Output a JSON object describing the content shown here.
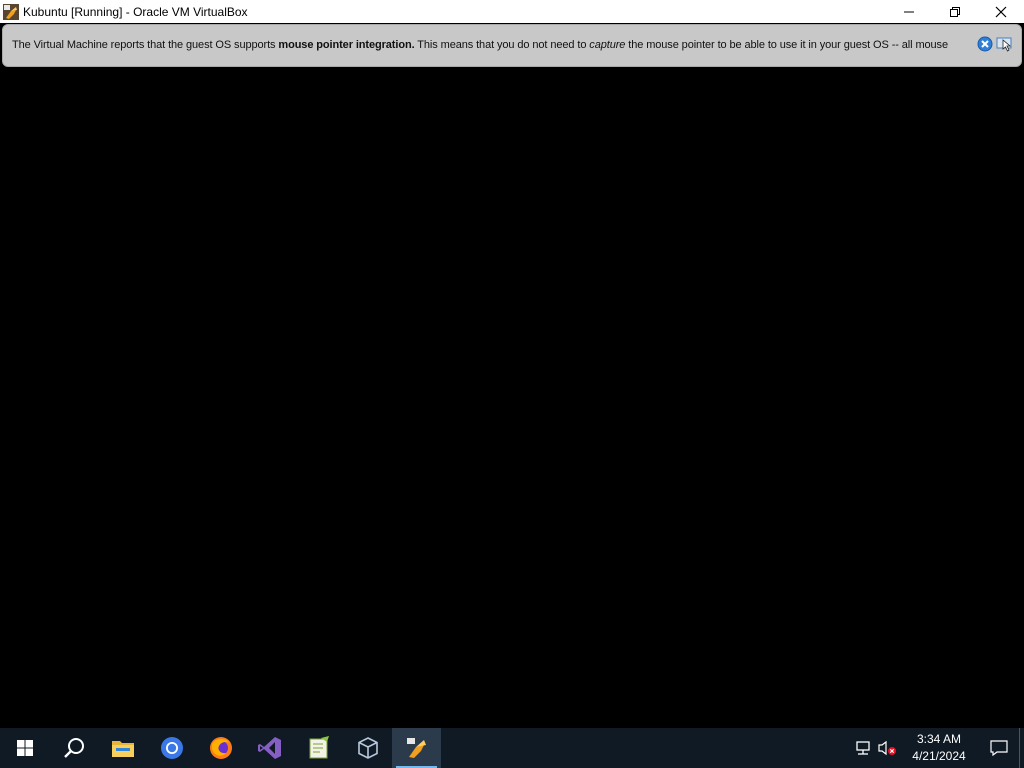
{
  "window": {
    "title": "Kubuntu [Running] - Oracle VM VirtualBox",
    "controls": [
      "minimize-icon",
      "restore-icon",
      "close-icon"
    ]
  },
  "notification": {
    "part1": "The Virtual Machine reports that the guest OS supports ",
    "bold": "mouse pointer integration.",
    "part2": " This means that you do not need to ",
    "italic": "capture",
    "part3": " the mouse pointer to be able to use it in your guest OS -- all mouse"
  },
  "taskbar": {
    "items": [
      "windows-start-icon",
      "search-icon",
      "file-explorer-icon",
      "chrome-icon",
      "firefox-icon",
      "visual-studio-icon",
      "notepad-plus-plus-icon",
      "virtualbox-icon",
      "virtualbox-vm-icon"
    ],
    "active_item": "virtualbox-vm-icon",
    "tray": [
      "network-icon",
      "volume-muted-icon"
    ],
    "time": "3:34 AM",
    "date": "4/21/2024"
  },
  "colors": {
    "taskbar": "#0f1a24",
    "notification_bg": "#c8c8c8",
    "accent": "#76b9ed"
  }
}
